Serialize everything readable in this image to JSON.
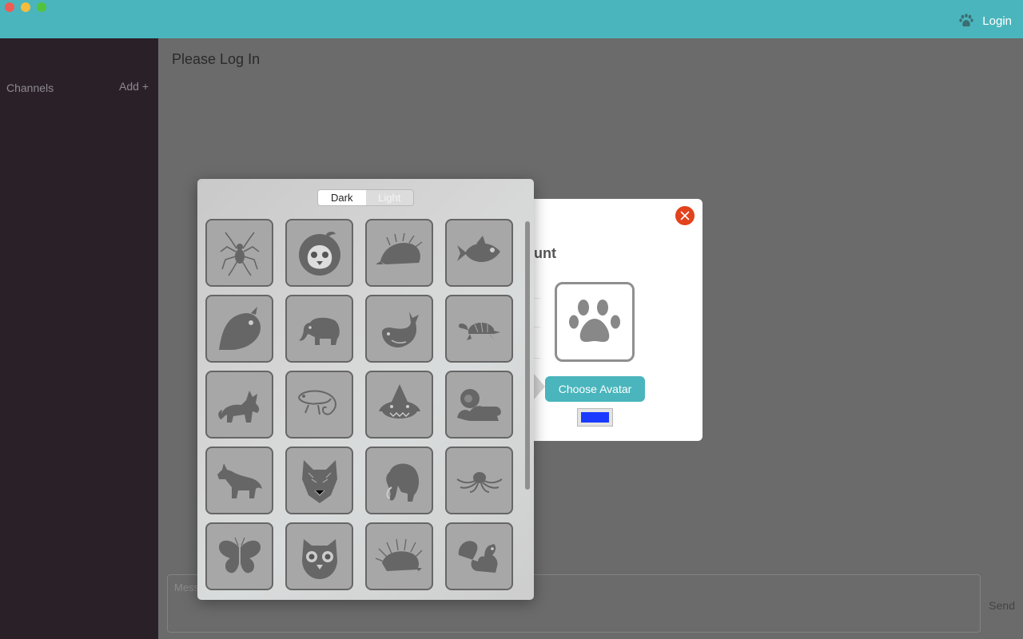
{
  "window": {
    "login_label": "Login",
    "colors": {
      "accent": "#4ab5bc",
      "sidebar": "#2a2028",
      "close": "#e2421c",
      "swatch": "#1a3aff"
    }
  },
  "sidebar": {
    "channels_label": "Channels",
    "add_label": "Add +"
  },
  "main": {
    "title": "Please Log In",
    "message_placeholder": "Mess",
    "send_label": "Send"
  },
  "dialog": {
    "heading": "ount",
    "avatar_icon": "paw-icon",
    "choose_label": "Choose Avatar",
    "color_swatch": "#1a3aff"
  },
  "avatar_picker": {
    "segments": [
      {
        "label": "Dark",
        "selected": true
      },
      {
        "label": "Light",
        "selected": false
      }
    ],
    "avatars": [
      "spider",
      "penguin",
      "hedgehog",
      "fish",
      "bird",
      "elephant",
      "whale",
      "turtle",
      "fox",
      "chameleon",
      "shark",
      "lion",
      "wolf",
      "wolf-head",
      "mammoth",
      "octopus",
      "butterfly",
      "owl",
      "porcupine",
      "squirrel"
    ]
  }
}
